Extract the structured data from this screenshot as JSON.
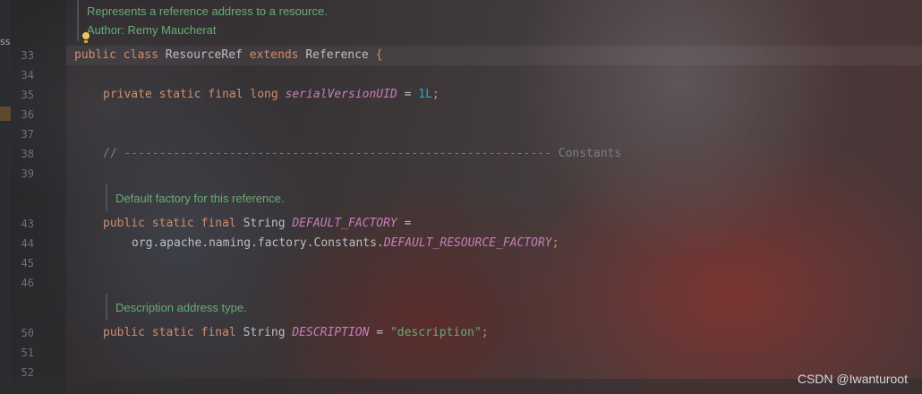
{
  "left_strip": {
    "text": "ss"
  },
  "doc_header": {
    "line1": "Represents a reference address to a resource.",
    "line2": "Author: Remy Maucherat"
  },
  "gutter": {
    "line_numbers": [
      "33",
      "34",
      "35",
      "36",
      "37",
      "38",
      "39",
      "43",
      "44",
      "45",
      "46",
      "50",
      "51",
      "52"
    ]
  },
  "code": {
    "class_decl": {
      "kw1": "public",
      "kw2": "class",
      "name": "ResourceRef",
      "kw3": "extends",
      "parent": "Reference",
      "brace": "{"
    },
    "serial": {
      "kw1": "private",
      "kw2": "static",
      "kw3": "final",
      "type": "long",
      "field": "serialVersionUID",
      "eq": "=",
      "value": "1L",
      "semi": ";"
    },
    "constants_comment": "// ------------------------------------------------------------- Constants",
    "doc_default_factory": "Default factory for this reference.",
    "default_factory": {
      "kw1": "public",
      "kw2": "static",
      "kw3": "final",
      "type": "String",
      "field": "DEFAULT_FACTORY",
      "eq": "="
    },
    "default_factory_value": {
      "pkg": "org.apache.naming.factory.Constants.",
      "field": "DEFAULT_RESOURCE_FACTORY",
      "semi": ";"
    },
    "doc_description": "Description address type.",
    "description": {
      "kw1": "public",
      "kw2": "static",
      "kw3": "final",
      "type": "String",
      "field": "DESCRIPTION",
      "eq": "=",
      "value": "\"description\"",
      "semi": ";"
    }
  },
  "watermark": "CSDN @Iwanturoot",
  "colors": {
    "keyword": "#cf8e6d",
    "field": "#c77dbb",
    "number": "#2aacb8",
    "string": "#6aab73",
    "doc_comment": "#6aab73",
    "line_comment": "#7a7e85",
    "line_number": "#6c707e",
    "bulb": "#f2c55c"
  },
  "icons": {
    "intention": "lightbulb-icon"
  }
}
